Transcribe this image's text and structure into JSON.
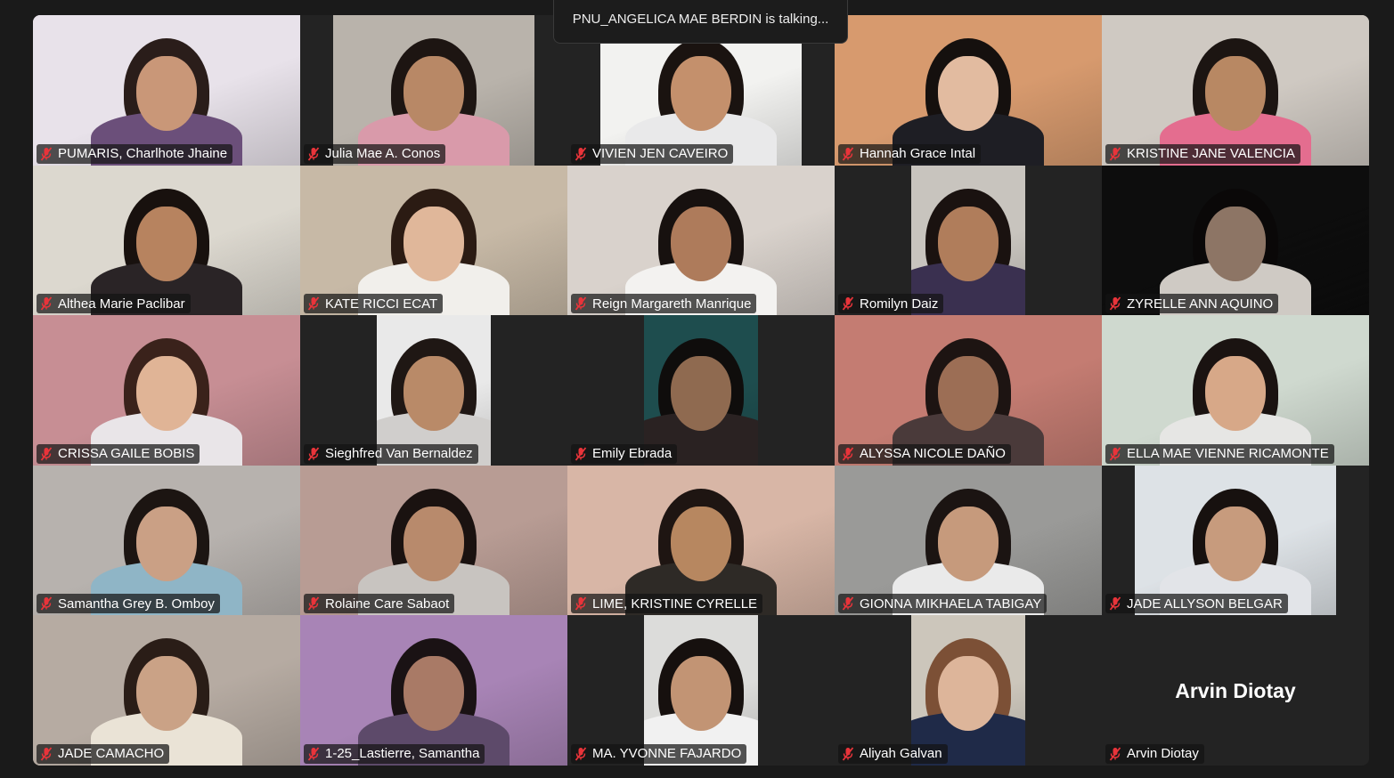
{
  "meeting": {
    "talking_indicator": "PNU_ANGELICA MAE BERDIN is talking..."
  },
  "participants": [
    {
      "name": "PUMARIS, Charlhote Jhaine",
      "muted": true,
      "video": true,
      "frame": "full",
      "bg": "#e8e2ea",
      "hair": "#2a1d1a",
      "skin": "#c99778",
      "shirt": "#6b4f7a"
    },
    {
      "name": "Julia Mae A. Conos",
      "muted": true,
      "video": true,
      "frame": "mid",
      "bg": "#b9b3ab",
      "hair": "#1d1512",
      "skin": "#b88866",
      "shirt": "#d99aaa"
    },
    {
      "name": "VIVIEN JEN CAVEIRO",
      "muted": true,
      "video": true,
      "frame": "mid",
      "bg": "#f2f2f0",
      "hair": "#1a1310",
      "skin": "#c4906c",
      "shirt": "#e9e9ea"
    },
    {
      "name": "Hannah Grace Intal",
      "muted": true,
      "video": true,
      "frame": "full",
      "bg": "#d79a6e",
      "hair": "#15100e",
      "skin": "#e2bba0",
      "shirt": "#1e1e24"
    },
    {
      "name": "KRISTINE JANE VALENCIA",
      "muted": true,
      "video": true,
      "frame": "full",
      "bg": "#cfc9c2",
      "hair": "#1c1512",
      "skin": "#b88863",
      "shirt": "#e46d8f"
    },
    {
      "name": "Althea Marie Paclibar",
      "muted": true,
      "video": true,
      "frame": "full",
      "bg": "#dcd8cf",
      "hair": "#18110e",
      "skin": "#b7835f",
      "shirt": "#2a2426"
    },
    {
      "name": "KATE RICCI ECAT",
      "muted": true,
      "video": true,
      "frame": "full",
      "bg": "#c7b9a6",
      "hair": "#2b1b13",
      "skin": "#e0b79a",
      "shirt": "#f1efeb"
    },
    {
      "name": "Reign Margareth Manrique",
      "muted": true,
      "video": true,
      "frame": "full",
      "bg": "#d9d2cc",
      "hair": "#17110f",
      "skin": "#ae7b5b",
      "shirt": "#f3f2f0"
    },
    {
      "name": "Romilyn Daiz",
      "muted": true,
      "video": true,
      "frame": "narrow",
      "bg": "#c8c4be",
      "hair": "#1a1210",
      "skin": "#b07d5b",
      "shirt": "#3a3050"
    },
    {
      "name": "ZYRELLE ANN AQUINO",
      "muted": true,
      "video": true,
      "frame": "full",
      "bg": "#0d0d0d",
      "hair": "#0a0808",
      "skin": "#8d7565",
      "shirt": "#cfcac4"
    },
    {
      "name": "CRISSA GAILE BOBIS",
      "muted": true,
      "video": true,
      "frame": "full",
      "bg": "#c78e94",
      "hair": "#3a221b",
      "skin": "#e0b496",
      "shirt": "#e9e5e8"
    },
    {
      "name": "Sieghfred Van Bernaldez",
      "muted": true,
      "video": true,
      "frame": "slim",
      "bg": "#e9e9e9",
      "hair": "#1f1714",
      "skin": "#b98a68",
      "shirt": "#d0cecc"
    },
    {
      "name": "Emily Ebrada",
      "muted": true,
      "video": true,
      "frame": "slim",
      "bg": "#1e4d4e",
      "hair": "#0f0d0c",
      "skin": "#8f6a50",
      "shirt": "#2a2222"
    },
    {
      "name": "ALYSSA NICOLE DAÑO",
      "muted": true,
      "video": true,
      "frame": "full",
      "bg": "#c47c72",
      "hair": "#1d1412",
      "skin": "#9c6e55",
      "shirt": "#4a3a3a"
    },
    {
      "name": "ELLA MAE VIENNE RICAMONTE",
      "muted": true,
      "video": true,
      "frame": "full",
      "bg": "#cfd9cf",
      "hair": "#1a1311",
      "skin": "#d7a888",
      "shirt": "#e6e6e4"
    },
    {
      "name": "Samantha Grey B. Omboy",
      "muted": true,
      "video": true,
      "frame": "full",
      "bg": "#b7b2ae",
      "hair": "#1c1512",
      "skin": "#caa085",
      "shirt": "#8fb5c6"
    },
    {
      "name": "Rolaine Care Sabaot",
      "muted": true,
      "video": true,
      "frame": "full",
      "bg": "#b89c94",
      "hair": "#1a1210",
      "skin": "#b88a6c",
      "shirt": "#c8c4c0"
    },
    {
      "name": "LIME, KRISTINE CYRELLE",
      "muted": true,
      "video": true,
      "frame": "full",
      "bg": "#d8b6a6",
      "hair": "#1e1512",
      "skin": "#b78760",
      "shirt": "#2e2a26"
    },
    {
      "name": "GIONNA MIKHAELA TABIGAY",
      "muted": true,
      "video": true,
      "frame": "full",
      "bg": "#9a9a98",
      "hair": "#1b1412",
      "skin": "#c69a7c",
      "shirt": "#eaeaea"
    },
    {
      "name": "JADE ALLYSON BELGAR",
      "muted": true,
      "video": true,
      "frame": "mid",
      "bg": "#dde2e6",
      "hair": "#17110f",
      "skin": "#c79b7d",
      "shirt": "#e2e4e8"
    },
    {
      "name": "JADE CAMACHO",
      "muted": true,
      "video": true,
      "frame": "full",
      "bg": "#b6aba2",
      "hair": "#2a1d17",
      "skin": "#caa286",
      "shirt": "#eae3d6"
    },
    {
      "name": "1-25_Lastierre, Samantha",
      "muted": true,
      "video": true,
      "frame": "full",
      "bg": "#a884b6",
      "hair": "#1a1214",
      "skin": "#a97a66",
      "shirt": "#5d4a6a"
    },
    {
      "name": "MA. YVONNE FAJARDO",
      "muted": true,
      "video": true,
      "frame": "slim",
      "bg": "#dcdcda",
      "hair": "#16100e",
      "skin": "#c29474",
      "shirt": "#f1f1f1"
    },
    {
      "name": "Aliyah Galvan",
      "muted": true,
      "video": true,
      "frame": "narrow",
      "bg": "#ccc6bb",
      "hair": "#7c5036",
      "skin": "#ddb59a",
      "shirt": "#1f2a48"
    },
    {
      "name": "Arvin Diotay",
      "muted": true,
      "video": false,
      "avatar_label": "Arvin Diotay",
      "bg": "#232323"
    }
  ],
  "icons": {
    "muted_mic": "mic-off-icon"
  },
  "colors": {
    "muted_icon": "#e8343a",
    "background": "#1a1a1a",
    "tile_background": "#232323"
  }
}
